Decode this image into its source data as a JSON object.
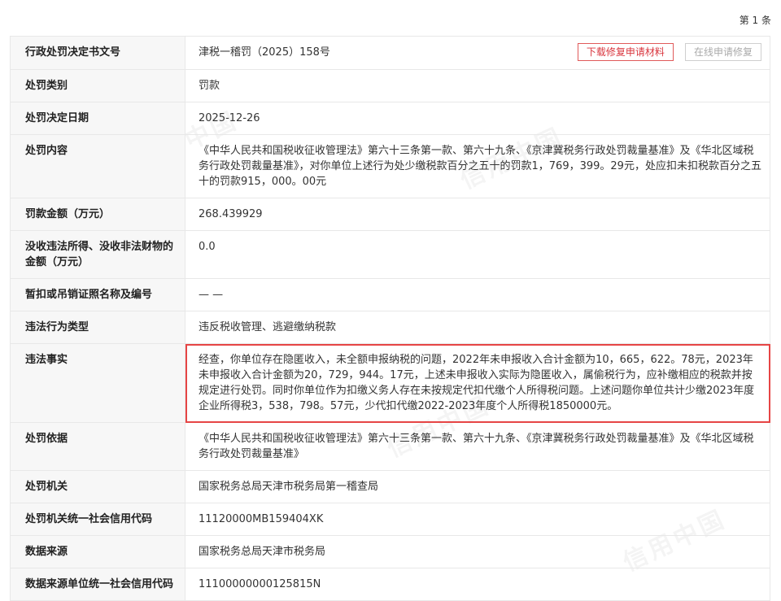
{
  "count_label": "第 1 条",
  "buttons": {
    "download": "下载修复申请材料",
    "online_repair": "在线申请修复"
  },
  "watermark_text": "信用中国",
  "rows": [
    {
      "key": "行政处罚决定书文号",
      "value": "津税一稽罚（2025）158号"
    },
    {
      "key": "处罚类别",
      "value": "罚款"
    },
    {
      "key": "处罚决定日期",
      "value": "2025-12-26"
    },
    {
      "key": "处罚内容",
      "value": "《中华人民共和国税收征收管理法》第六十三条第一款、第六十九条、《京津冀税务行政处罚裁量基准》及《华北区域税务行政处罚裁量基准》，对你单位上述行为处少缴税款百分之五十的罚款1，769，399。29元，处应扣未扣税款百分之五十的罚款915，000。00元"
    },
    {
      "key": "罚款金额（万元）",
      "value": "268.439929"
    },
    {
      "key": "没收违法所得、没收非法财物的金额（万元）",
      "value": "0.0"
    },
    {
      "key": "暂扣或吊销证照名称及编号",
      "value": "— —"
    },
    {
      "key": "违法行为类型",
      "value": "违反税收管理、逃避缴纳税款"
    },
    {
      "key": "违法事实",
      "value": "经查，你单位存在隐匿收入，未全额申报纳税的问题，2022年未申报收入合计金额为10，665，622。78元，2023年未申报收入合计金额为20，729，944。17元，上述未申报收入实际为隐匿收入，属偷税行为，应补缴相应的税款并按规定进行处罚。同时你单位作为扣缴义务人存在未按规定代扣代缴个人所得税问题。上述问题你单位共计少缴2023年度企业所得税3，538，798。57元，少代扣代缴2022-2023年度个人所得税1850000元。"
    },
    {
      "key": "处罚依据",
      "value": "《中华人民共和国税收征收管理法》第六十三条第一款、第六十九条、《京津冀税务行政处罚裁量基准》及《华北区域税务行政处罚裁量基准》"
    },
    {
      "key": "处罚机关",
      "value": "国家税务总局天津市税务局第一稽查局"
    },
    {
      "key": "处罚机关统一社会信用代码",
      "value": "11120000MB159404XK"
    },
    {
      "key": "数据来源",
      "value": "国家税务总局天津市税务局"
    },
    {
      "key": "数据来源单位统一社会信用代码",
      "value": "11100000000125815N"
    }
  ]
}
